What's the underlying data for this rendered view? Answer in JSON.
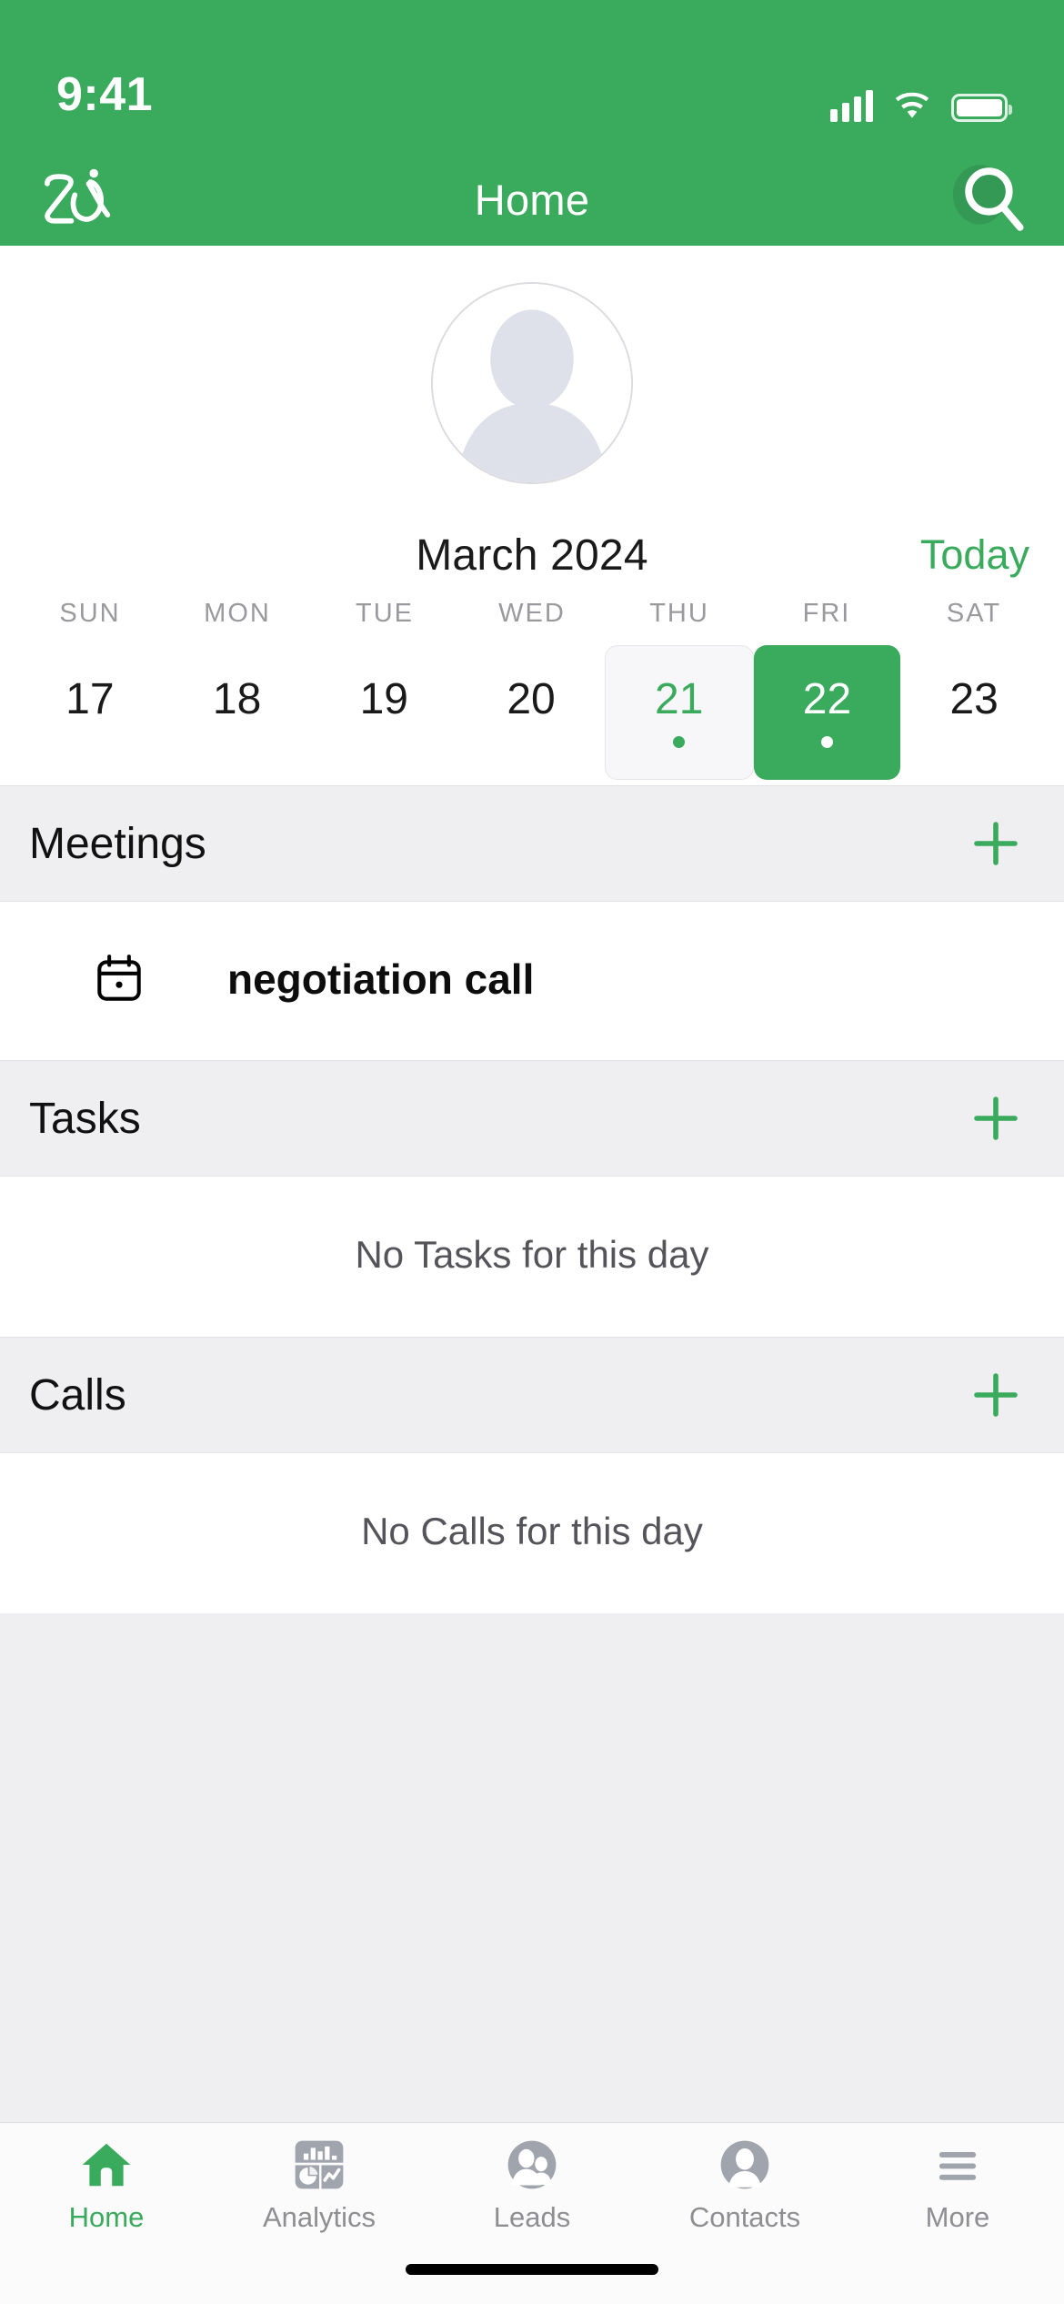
{
  "status_bar": {
    "time": "9:41",
    "signal_icon": "cellular-signal-icon",
    "wifi_icon": "wifi-icon",
    "battery_icon": "battery-icon"
  },
  "nav_bar": {
    "logo_label": "Zia",
    "logo_icon": "zia-logo-icon",
    "title": "Home",
    "search_icon": "search-icon"
  },
  "profile": {
    "avatar_icon": "user-avatar-placeholder-icon"
  },
  "calendar": {
    "month_label": "March 2024",
    "today_label": "Today",
    "weekdays": [
      "SUN",
      "MON",
      "TUE",
      "WED",
      "THU",
      "FRI",
      "SAT"
    ],
    "days": [
      {
        "number": "17",
        "state": "normal",
        "has_dot": false
      },
      {
        "number": "18",
        "state": "normal",
        "has_dot": false
      },
      {
        "number": "19",
        "state": "normal",
        "has_dot": false
      },
      {
        "number": "20",
        "state": "normal",
        "has_dot": false
      },
      {
        "number": "21",
        "state": "today",
        "has_dot": true
      },
      {
        "number": "22",
        "state": "selected",
        "has_dot": true
      },
      {
        "number": "23",
        "state": "normal",
        "has_dot": false
      }
    ]
  },
  "sections": {
    "meetings": {
      "title": "Meetings",
      "add_icon": "plus-icon",
      "items": [
        {
          "title": "negotiation call",
          "icon": "calendar-event-icon"
        }
      ]
    },
    "tasks": {
      "title": "Tasks",
      "add_icon": "plus-icon",
      "empty_text": "No Tasks for this day"
    },
    "calls": {
      "title": "Calls",
      "add_icon": "plus-icon",
      "empty_text": "No Calls for this day"
    }
  },
  "tab_bar": {
    "tabs": [
      {
        "label": "Home",
        "icon": "home-icon",
        "active": true
      },
      {
        "label": "Analytics",
        "icon": "analytics-icon",
        "active": false
      },
      {
        "label": "Leads",
        "icon": "leads-icon",
        "active": false
      },
      {
        "label": "Contacts",
        "icon": "contacts-icon",
        "active": false
      },
      {
        "label": "More",
        "icon": "hamburger-menu-icon",
        "active": false
      }
    ]
  },
  "colors": {
    "brand_green": "#3aaa5d",
    "section_gray": "#efeff1",
    "muted_text": "#8e8e93",
    "icon_gray": "#9fa4ad"
  }
}
